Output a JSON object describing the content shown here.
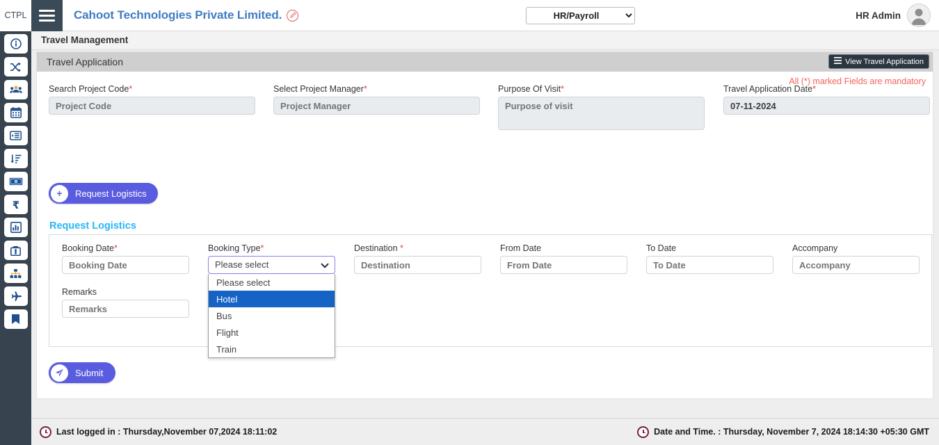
{
  "topbar": {
    "brand_tag": "CTPL",
    "company": "Cahoot Technologies Private Limited.",
    "module_selected": "HR/Payroll",
    "module_options": [
      "HR/Payroll"
    ],
    "user_name": "HR Admin"
  },
  "sidebar": {
    "items": [
      {
        "icon": "info-circle-icon",
        "name": "info"
      },
      {
        "icon": "shuffle-icon",
        "name": "shuffle"
      },
      {
        "icon": "users-icon",
        "name": "users"
      },
      {
        "icon": "calendar-icon",
        "name": "calendar"
      },
      {
        "icon": "list-indent-icon",
        "name": "list"
      },
      {
        "icon": "sort-amount-down-icon",
        "name": "sort"
      },
      {
        "icon": "money-bill-icon",
        "name": "payroll"
      },
      {
        "icon": "rupee-icon",
        "name": "rupee"
      },
      {
        "icon": "chart-bar-icon",
        "name": "reports"
      },
      {
        "icon": "briefcase-icon",
        "name": "briefcase"
      },
      {
        "icon": "sitemap-icon",
        "name": "sitemap"
      },
      {
        "icon": "plane-icon",
        "name": "travel"
      },
      {
        "icon": "bookmark-icon",
        "name": "bookmark"
      }
    ]
  },
  "page": {
    "title": "Travel Management",
    "card_title": "Travel Application",
    "view_button": "View Travel Application",
    "mandatory_note": "All (*) marked Fields are mandatory"
  },
  "form": {
    "project_code": {
      "label": "Search Project Code",
      "required": "*",
      "placeholder": "Project Code",
      "value": ""
    },
    "project_manager": {
      "label": "Select Project Manager",
      "required": "*",
      "placeholder": "Project Manager",
      "value": ""
    },
    "purpose": {
      "label": "Purpose Of Visit",
      "required": "*",
      "placeholder": "Purpose of visit",
      "value": ""
    },
    "application_date": {
      "label": "Travel Application Date",
      "required": "*",
      "placeholder": "Travel Application Date",
      "value": "07-11-2024"
    }
  },
  "request_logistics_button": "Request Logistics",
  "logistics": {
    "section_title": "Request Logistics",
    "booking_date": {
      "label": "Booking Date",
      "required": "*",
      "placeholder": "Booking Date",
      "value": ""
    },
    "booking_type": {
      "label": "Booking Type",
      "required": "*",
      "selected": "Please select",
      "options": [
        "Please select",
        "Hotel",
        "Bus",
        "Flight",
        "Train"
      ],
      "highlighted": "Hotel"
    },
    "destination": {
      "label": "Destination ",
      "required": "*",
      "placeholder": "Destination",
      "value": ""
    },
    "from_date": {
      "label": "From Date",
      "required": "",
      "placeholder": "From Date",
      "value": ""
    },
    "to_date": {
      "label": "To Date",
      "required": "",
      "placeholder": "To Date",
      "value": ""
    },
    "accompany": {
      "label": "Accompany",
      "required": "",
      "placeholder": "Accompany",
      "value": ""
    },
    "remarks": {
      "label": "Remarks",
      "required": "",
      "placeholder": "Remarks",
      "value": ""
    }
  },
  "submit_button": "Submit",
  "footer": {
    "last_logged_in": "Last logged in : Thursday,November 07,2024 18:11:02",
    "date_time": "Date and Time. : Thursday, November 7, 2024 18:14:30  +05:30 GMT"
  }
}
